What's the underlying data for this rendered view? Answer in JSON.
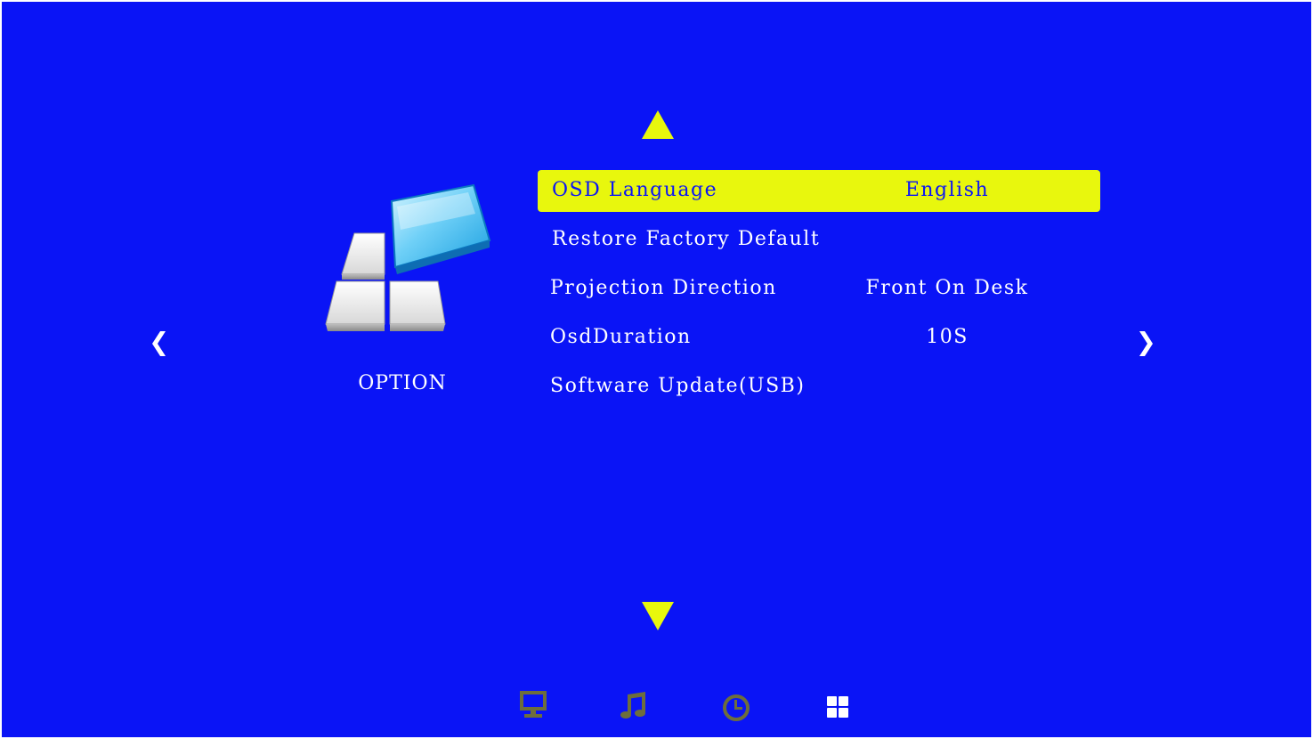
{
  "colors": {
    "background": "#0a14f6",
    "highlight": "#e8f70d",
    "text": "#ffffff",
    "inactive_icon": "#6e6e3c",
    "active_icon": "#ffffff"
  },
  "category": {
    "icon": "option-tiles-icon",
    "label": "OPTION"
  },
  "navigation": {
    "up_icon": "triangle-up-icon",
    "down_icon": "triangle-down-icon",
    "left_icon": "chevron-left-icon",
    "right_icon": "chevron-right-icon"
  },
  "menu": {
    "items": [
      {
        "label": "OSD Language",
        "value": "English",
        "selected": true
      },
      {
        "label": "Restore Factory Default",
        "value": ""
      },
      {
        "label": "Projection Direction",
        "value": "Front On Desk"
      },
      {
        "label": "OsdDuration",
        "value": "10S"
      },
      {
        "label": "Software Update(USB)",
        "value": ""
      }
    ]
  },
  "bottom_nav": {
    "items": [
      {
        "icon": "monitor-icon",
        "active": false
      },
      {
        "icon": "music-note-icon",
        "active": false
      },
      {
        "icon": "clock-icon",
        "active": false
      },
      {
        "icon": "grid-icon",
        "active": true
      }
    ]
  }
}
